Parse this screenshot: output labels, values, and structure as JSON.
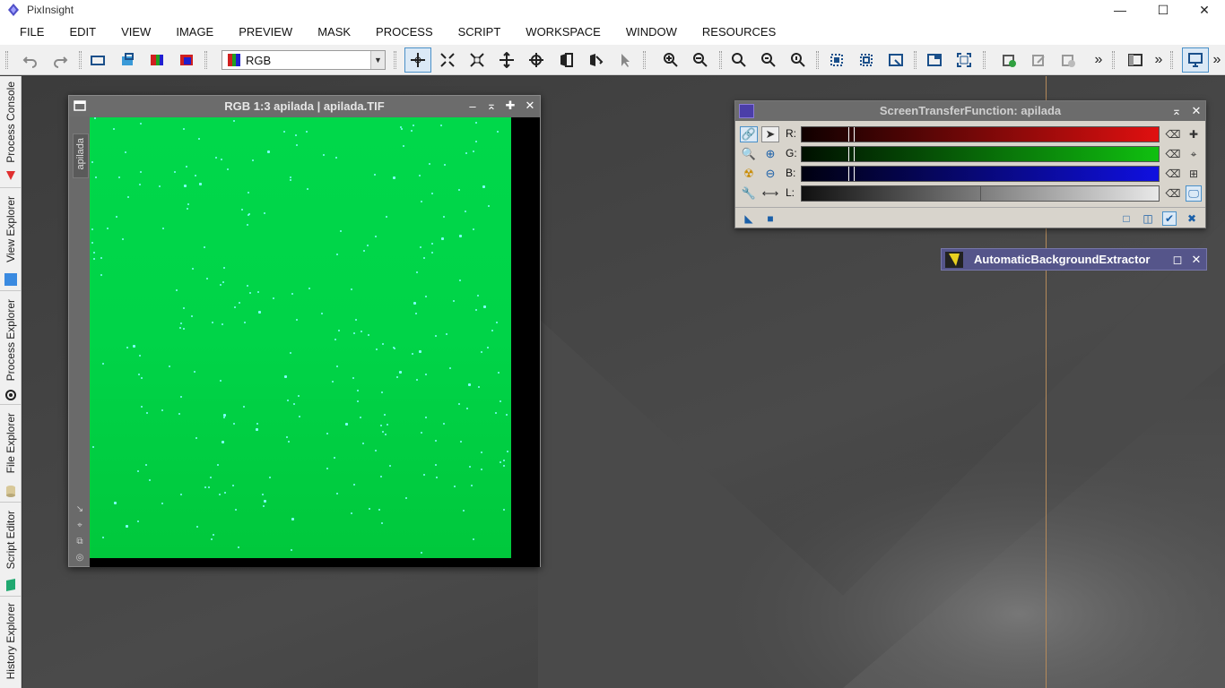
{
  "app": {
    "title": "PixInsight"
  },
  "menu": [
    "FILE",
    "EDIT",
    "VIEW",
    "IMAGE",
    "PREVIEW",
    "MASK",
    "PROCESS",
    "SCRIPT",
    "WORKSPACE",
    "WINDOW",
    "RESOURCES"
  ],
  "toolbar": {
    "view_select": "RGB",
    "overflow_1": "»",
    "overflow_2": "»",
    "overflow_3": "»"
  },
  "dock": {
    "tabs": [
      "Process Console",
      "View Explorer",
      "Process Explorer",
      "File Explorer",
      "Script Editor",
      "History Explorer"
    ]
  },
  "image_window": {
    "title": "RGB 1:3 apilada | apilada.TIF",
    "side_tab": "apilada"
  },
  "stf": {
    "title": "ScreenTransferFunction: apilada",
    "channels": [
      "R:",
      "G:",
      "B:",
      "L:"
    ]
  },
  "abe": {
    "label": "AutomaticBackgroundExtractor"
  },
  "colors": {
    "image_green": "#00d448",
    "stf_red": "#e01010",
    "stf_green": "#10c010",
    "stf_blue": "#1010e0",
    "accent": "#4a90c8"
  }
}
